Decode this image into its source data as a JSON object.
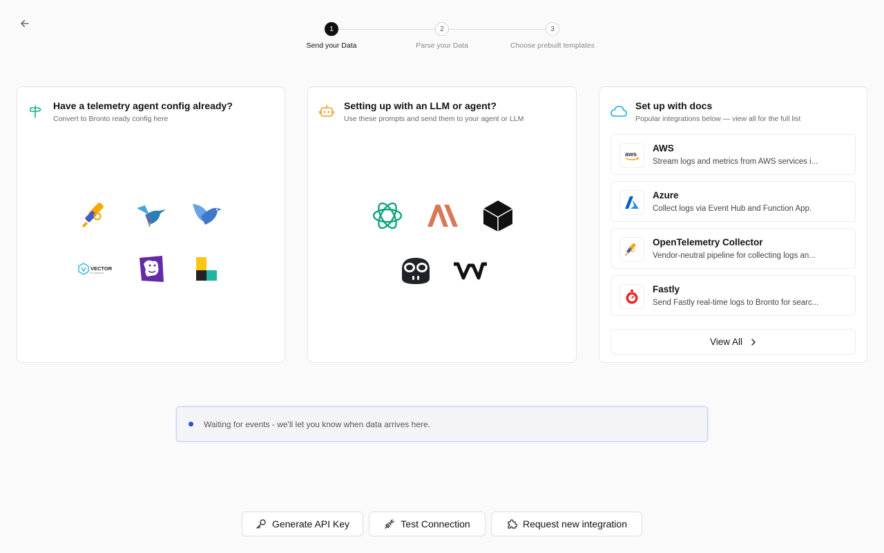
{
  "stepper": {
    "steps": [
      {
        "number": "1",
        "label": "Send your Data",
        "state": "active"
      },
      {
        "number": "2",
        "label": "Parse your Data",
        "state": "inactive"
      },
      {
        "number": "3",
        "label": "Choose prebuilt templates",
        "state": "inactive"
      }
    ]
  },
  "cards": {
    "agent_config": {
      "title": "Have a telemetry agent config already?",
      "subtitle": "Convert to Bronto ready config here",
      "icon": "signpost-icon",
      "logos": [
        "opentelemetry-logo",
        "hummingbird-logo",
        "fluentd-bird-logo",
        "vector-logo",
        "datadog-logo",
        "elastic-logo"
      ]
    },
    "llm": {
      "title": "Setting up with an LLM or agent?",
      "subtitle": "Use these prompts and send them to your agent or LLM",
      "icon": "robot-icon",
      "logos": [
        "openai-logo",
        "anthropic-logo",
        "cursor-logo",
        "copilot-logo",
        "windsurf-logo"
      ]
    },
    "docs": {
      "title": "Set up with docs",
      "subtitle": "Popular integrations below — view all for the full list",
      "icon": "cloud-icon",
      "integrations": [
        {
          "name": "AWS",
          "description": "Stream logs and metrics from AWS services i...",
          "icon": "aws-icon"
        },
        {
          "name": "Azure",
          "description": "Collect logs via Event Hub and Function App.",
          "icon": "azure-icon"
        },
        {
          "name": "OpenTelemetry Collector",
          "description": "Vendor-neutral pipeline for collecting logs an...",
          "icon": "opentelemetry-icon"
        },
        {
          "name": "Fastly",
          "description": "Send Fastly real-time logs to Bronto for searc...",
          "icon": "fastly-icon"
        }
      ],
      "view_all_label": "View All"
    }
  },
  "status": {
    "text": "Waiting for events - we'll let you know when data arrives here."
  },
  "actions": {
    "generate_api_key": "Generate API Key",
    "test_connection": "Test Connection",
    "request_integration": "Request new integration"
  },
  "colors": {
    "accent_blue": "#2752d8",
    "teal": "#10a37f",
    "anthropic": "#d97757"
  }
}
